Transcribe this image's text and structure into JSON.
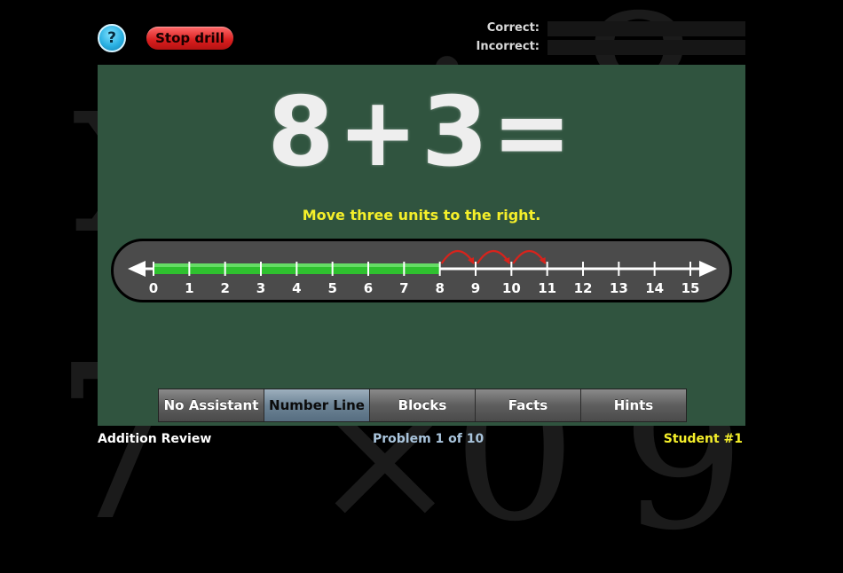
{
  "header": {
    "help_label": "?",
    "stop_label": "Stop drill",
    "correct_label": "Correct:",
    "incorrect_label": "Incorrect:",
    "correct_value": "",
    "incorrect_value": ""
  },
  "board": {
    "equation": "8+3=",
    "instruction": "Move three units to the right."
  },
  "number_line": {
    "min": 0,
    "max": 15,
    "ticks": [
      "0",
      "1",
      "2",
      "3",
      "4",
      "5",
      "6",
      "7",
      "8",
      "9",
      "10",
      "11",
      "12",
      "13",
      "14",
      "15"
    ],
    "start_value": 8,
    "hops": [
      9,
      10,
      11
    ],
    "highlight_color": "#2fc12f",
    "hop_color": "#d8231c"
  },
  "tabs": [
    {
      "label": "No Assistant",
      "active": false
    },
    {
      "label": "Number Line",
      "active": true
    },
    {
      "label": "Blocks",
      "active": false
    },
    {
      "label": "Facts",
      "active": false
    },
    {
      "label": "Hints",
      "active": false
    }
  ],
  "footer": {
    "lesson": "Addition Review",
    "progress": "Problem 1 of 10",
    "student": "Student #1"
  },
  "colors": {
    "board": "#30543f",
    "instruction": "#f5ef2a",
    "student": "#f5ef2a",
    "progress": "#a9c4dc"
  },
  "icons": {
    "help": "question-mark-icon",
    "arrow_left": "arrow-left-icon",
    "arrow_right": "arrow-right-icon"
  }
}
